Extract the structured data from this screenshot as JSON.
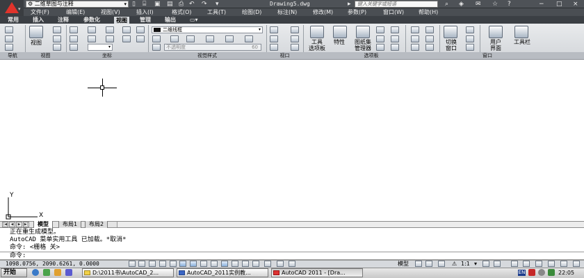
{
  "titlebar": {
    "workspace": "二维草图与注释",
    "doc_title": "Drawing5.dwg",
    "search_placeholder": "键入关键字或短语",
    "window_buttons": [
      "−",
      "□",
      "×"
    ]
  },
  "menubar": [
    "文件(F)",
    "编辑(E)",
    "视图(V)",
    "插入(I)",
    "格式(O)",
    "工具(T)",
    "绘图(D)",
    "标注(N)",
    "修改(M)",
    "参数(P)",
    "窗口(W)",
    "帮助(H)"
  ],
  "ribbon_tabs": [
    "常用",
    "插入",
    "注释",
    "参数化",
    "视图",
    "管理",
    "输出"
  ],
  "active_tab": "视图",
  "ribbon": {
    "view_label": "视图",
    "visual_style": "二维线框",
    "opacity_label": "不透明度",
    "opacity_value": "60",
    "tool_palette": "工具\n选项板",
    "properties": "特性",
    "sheet_set": "图纸集\n管理器",
    "switch_window": "切换\n窗口",
    "user_interface": "用户\n界面",
    "toolbars": "工具栏",
    "panels": [
      "导航",
      "视图",
      "坐标",
      "视觉样式",
      "视口",
      "选项板",
      "窗口"
    ]
  },
  "canvas": {
    "ucs_y": "Y",
    "ucs_x": "X"
  },
  "layout_tabs": [
    "模型",
    "布局1",
    "布局2"
  ],
  "command": {
    "history": [
      "正在重生成模型。",
      "AutoCAD 菜单实用工具 已加载。*取消*",
      "命令: <栅格 关>"
    ],
    "prompt": "命令:"
  },
  "statusbar": {
    "coords": "1098.0756, 2090.6261, 0.0000",
    "model_label": "模型",
    "scale": "1:1"
  },
  "taskbar": {
    "start": "开始",
    "buttons": [
      "D:\\2011书\\AutoCAD_2...",
      "AutoCAD_2011实例教...",
      "AutoCAD 2011 - [Dra..."
    ],
    "lang": "EN",
    "clock": "22:05"
  },
  "colors": {
    "titlebar": "#4e5257",
    "ribbon": "#d9dcdf",
    "logo": "#e0332b"
  }
}
